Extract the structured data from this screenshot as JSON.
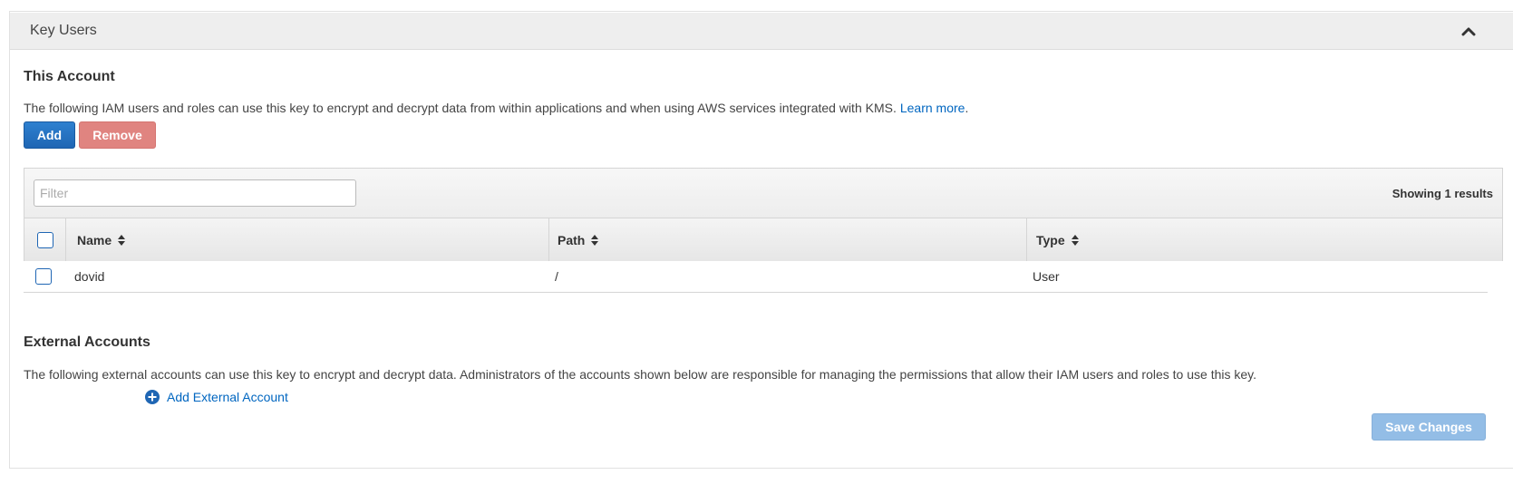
{
  "header": {
    "title": "Key Users"
  },
  "this_account": {
    "title": "This Account",
    "description": "The following IAM users and roles can use this key to encrypt and decrypt data from within applications and when using AWS services integrated with KMS.",
    "learn_more": "Learn more",
    "learn_more_suffix": ".",
    "add_label": "Add",
    "remove_label": "Remove",
    "filter_placeholder": "Filter",
    "results_text": "Showing 1 results",
    "columns": [
      "Name",
      "Path",
      "Type"
    ],
    "rows": [
      {
        "name": "dovid",
        "path": "/",
        "type": "User"
      }
    ]
  },
  "external_accounts": {
    "title": "External Accounts",
    "description": "The following external accounts can use this key to encrypt and decrypt data. Administrators of the accounts shown below are responsible for managing the permissions that allow their IAM users and roles to use this key.",
    "add_label": "Add External Account"
  },
  "save_label": "Save Changes",
  "colors": {
    "primary": "#1f66b4",
    "danger": "#e08480",
    "link": "#0066c0",
    "save_disabled": "#93bde6"
  }
}
